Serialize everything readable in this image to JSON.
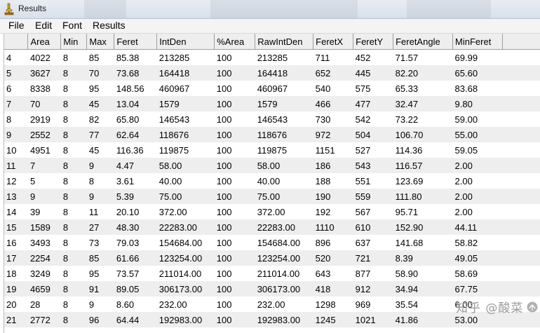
{
  "window": {
    "title": "Results"
  },
  "menu": [
    "File",
    "Edit",
    "Font",
    "Results"
  ],
  "columns": [
    "",
    "Area",
    "Min",
    "Max",
    "Feret",
    "IntDen",
    "%Area",
    "RawIntDen",
    "FeretX",
    "FeretY",
    "FeretAngle",
    "MinFeret"
  ],
  "rows": [
    [
      "4",
      "4022",
      "8",
      "85",
      "85.38",
      "213285",
      "100",
      "213285",
      "711",
      "452",
      "71.57",
      "69.99"
    ],
    [
      "5",
      "3627",
      "8",
      "70",
      "73.68",
      "164418",
      "100",
      "164418",
      "652",
      "445",
      "82.20",
      "65.60"
    ],
    [
      "6",
      "8338",
      "8",
      "95",
      "148.56",
      "460967",
      "100",
      "460967",
      "540",
      "575",
      "65.33",
      "83.68"
    ],
    [
      "7",
      "70",
      "8",
      "45",
      "13.04",
      "1579",
      "100",
      "1579",
      "466",
      "477",
      "32.47",
      "9.80"
    ],
    [
      "8",
      "2919",
      "8",
      "82",
      "65.80",
      "146543",
      "100",
      "146543",
      "730",
      "542",
      "73.22",
      "59.00"
    ],
    [
      "9",
      "2552",
      "8",
      "77",
      "62.64",
      "118676",
      "100",
      "118676",
      "972",
      "504",
      "106.70",
      "55.00"
    ],
    [
      "10",
      "4951",
      "8",
      "45",
      "116.36",
      "119875",
      "100",
      "119875",
      "1151",
      "527",
      "114.36",
      "59.05"
    ],
    [
      "11",
      "7",
      "8",
      "9",
      "4.47",
      "58.00",
      "100",
      "58.00",
      "186",
      "543",
      "116.57",
      "2.00"
    ],
    [
      "12",
      "5",
      "8",
      "8",
      "3.61",
      "40.00",
      "100",
      "40.00",
      "188",
      "551",
      "123.69",
      "2.00"
    ],
    [
      "13",
      "9",
      "8",
      "9",
      "5.39",
      "75.00",
      "100",
      "75.00",
      "190",
      "559",
      "111.80",
      "2.00"
    ],
    [
      "14",
      "39",
      "8",
      "11",
      "20.10",
      "372.00",
      "100",
      "372.00",
      "192",
      "567",
      "95.71",
      "2.00"
    ],
    [
      "15",
      "1589",
      "8",
      "27",
      "48.30",
      "22283.00",
      "100",
      "22283.00",
      "1110",
      "610",
      "152.90",
      "44.11"
    ],
    [
      "16",
      "3493",
      "8",
      "73",
      "79.03",
      "154684.00",
      "100",
      "154684.00",
      "896",
      "637",
      "141.68",
      "58.82"
    ],
    [
      "17",
      "2254",
      "8",
      "85",
      "61.66",
      "123254.00",
      "100",
      "123254.00",
      "520",
      "721",
      "8.39",
      "49.05"
    ],
    [
      "18",
      "3249",
      "8",
      "95",
      "73.57",
      "211014.00",
      "100",
      "211014.00",
      "643",
      "877",
      "58.90",
      "58.69"
    ],
    [
      "19",
      "4659",
      "8",
      "91",
      "89.05",
      "306173.00",
      "100",
      "306173.00",
      "418",
      "912",
      "34.94",
      "67.75"
    ],
    [
      "20",
      "28",
      "8",
      "9",
      "8.60",
      "232.00",
      "100",
      "232.00",
      "1298",
      "969",
      "35.54",
      "6.00"
    ],
    [
      "21",
      "2772",
      "8",
      "96",
      "64.44",
      "192983.00",
      "100",
      "192983.00",
      "1245",
      "1021",
      "41.86",
      "53.00"
    ]
  ],
  "watermark": {
    "text": "知乎 @酸菜"
  },
  "colors": {
    "row_even": "#eeeeee",
    "row_odd": "#ffffff",
    "header_bg": "#eeeeee",
    "grid": "#9e9e9e"
  }
}
